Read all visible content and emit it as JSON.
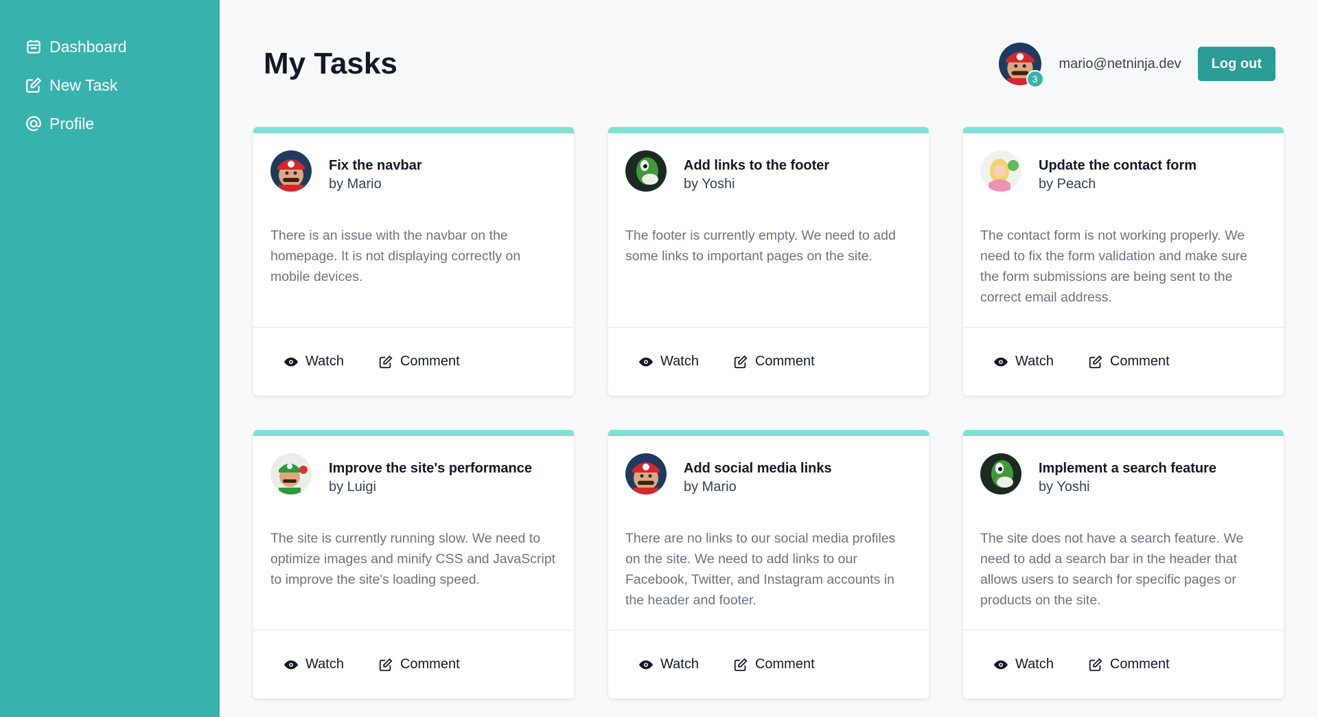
{
  "sidebar": {
    "items": [
      {
        "label": "Dashboard",
        "icon": "calendar-icon"
      },
      {
        "label": "New Task",
        "icon": "edit-icon"
      },
      {
        "label": "Profile",
        "icon": "at-icon"
      }
    ]
  },
  "header": {
    "title": "My Tasks",
    "user_email": "mario@netninja.dev",
    "notification_count": "3",
    "logout_label": "Log out"
  },
  "actions": {
    "watch_label": "Watch",
    "comment_label": "Comment"
  },
  "colors": {
    "sidebar": "#38b2ac",
    "accent": "#2c9c96",
    "card_top": "#81e0d6"
  },
  "tasks": [
    {
      "title": "Fix the navbar",
      "author": "by Mario",
      "avatar": "mario",
      "description": "There is an issue with the navbar on the homepage. It is not displaying correctly on mobile devices."
    },
    {
      "title": "Add links to the footer",
      "author": "by Yoshi",
      "avatar": "yoshi",
      "description": "The footer is currently empty. We need to add some links to important pages on the site."
    },
    {
      "title": "Update the contact form",
      "author": "by Peach",
      "avatar": "peach",
      "description": "The contact form is not working properly. We need to fix the form validation and make sure the form submissions are being sent to the correct email address."
    },
    {
      "title": "Improve the site's performance",
      "author": "by Luigi",
      "avatar": "luigi",
      "description": "The site is currently running slow. We need to optimize images and minify CSS and JavaScript to improve the site's loading speed."
    },
    {
      "title": "Add social media links",
      "author": "by Mario",
      "avatar": "mario",
      "description": "There are no links to our social media profiles on the site. We need to add links to our Facebook, Twitter, and Instagram accounts in the header and footer."
    },
    {
      "title": "Implement a search feature",
      "author": "by Yoshi",
      "avatar": "yoshi",
      "description": "The site does not have a search feature. We need to add a search bar in the header that allows users to search for specific pages or products on the site."
    }
  ]
}
